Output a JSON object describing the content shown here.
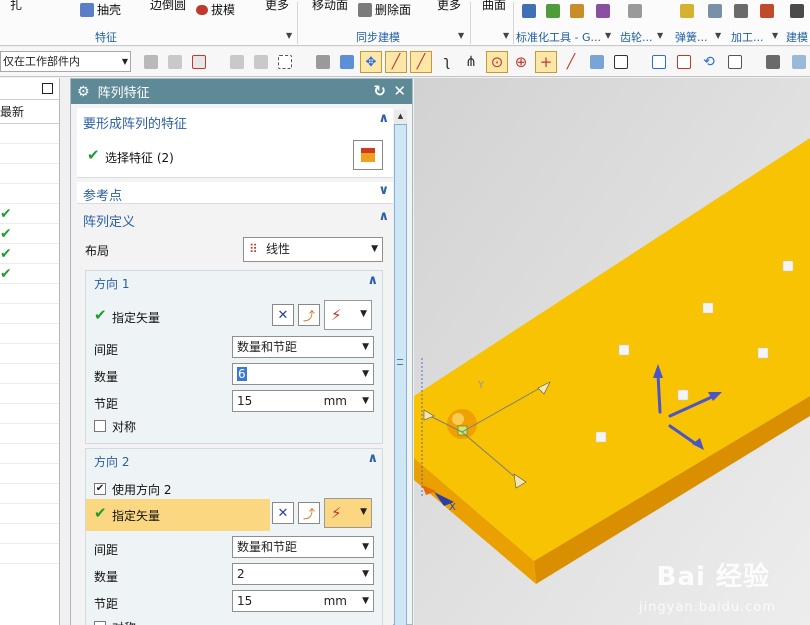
{
  "ribbon": {
    "items": [
      "扎",
      "抽壳",
      "边倒圆",
      "拔模",
      "更多",
      "移动面",
      "删除面",
      "更多",
      "曲面"
    ],
    "groups": [
      "特征",
      "同步建模",
      "标准化工具 - G...",
      "齿轮...",
      "弹簧...",
      "加工...",
      "建模"
    ]
  },
  "toolbar": {
    "filter_value": "仅在工作部件内"
  },
  "navigator": {
    "column_label": "最新"
  },
  "dialog": {
    "title": "阵列特征",
    "sections": {
      "features": {
        "header": "要形成阵列的特征",
        "select_label": "选择特征 (2)"
      },
      "reference": {
        "header": "参考点"
      },
      "definition": {
        "header": "阵列定义",
        "layout_label": "布局",
        "layout_value": "线性"
      }
    },
    "direction1": {
      "header": "方向 1",
      "vector_label": "指定矢量",
      "spacing_label": "间距",
      "spacing_value": "数量和节距",
      "count_label": "数量",
      "count_value": "6",
      "pitch_label": "节距",
      "pitch_value": "15",
      "pitch_unit": "mm",
      "symmetric_label": "对称"
    },
    "direction2": {
      "header": "方向 2",
      "use_label": "使用方向 2",
      "vector_label": "指定矢量",
      "spacing_label": "间距",
      "spacing_value": "数量和节距",
      "count_label": "数量",
      "count_value": "2",
      "pitch_label": "节距",
      "pitch_value": "15",
      "pitch_unit": "mm",
      "symmetric_label": "对称"
    }
  },
  "viewport": {
    "axis_y": "Y",
    "axis_x": "X",
    "watermark": "Bai 经验",
    "watermark_url": "jingyan.baidu.com"
  },
  "colors": {
    "plate_top": "#f7c302",
    "plate_side": "#d98f00",
    "dialog_title": "#5e8a98",
    "section_header": "#2a5fa5",
    "check_green": "#1f9e2f"
  }
}
